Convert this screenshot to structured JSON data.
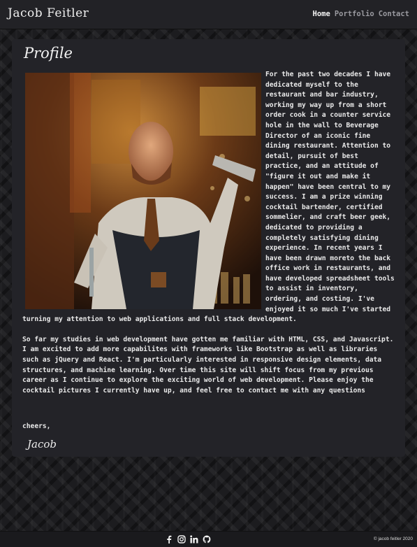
{
  "header": {
    "brand": "Jacob Feitler",
    "nav": [
      "Home",
      "Portfolio",
      "Contact"
    ]
  },
  "profile": {
    "title": "Profile",
    "paragraph1": "For the past two decades I have dedicated myself to the restaurant and bar industry, working my way up from a short order cook in a counter service hole in the wall to Beverage Director of an iconic fine dining restaurant. Attention to detail, pursuit of best practice, and an attitude of \"figure it out and make it happen\" have been central to my success. I am a prize winning cocktail bartender, certified sommelier, and craft beer geek, dedicated to providing a completely satisfying dining experience. In recent years I have been drawn moreto the back office work in restaurants, and have developed spreadsheet tools to assist in inventory, ordering, and costing. I've enjoyed it so much I've started turning my attention to web applications and full stack development.",
    "paragraph2": "So far my studies in web development have gotten me familiar with HTML, CSS, and Javascript. I am excited to add more capabilites with frameworks like Bootstrap as well as libraries such as jQuery and React. I'm particularly interested in responsive design elements, data structures, and machine learning. Over time this site will shift focus from my previous career as I continue to explore the exciting world of web development. Please enjoy the cocktail pictures I currently have up, and feel free to contact me with any questions",
    "closing": "cheers,",
    "signature": "Jacob"
  },
  "footer": {
    "icons": [
      "facebook-icon",
      "instagram-icon",
      "linkedin-icon",
      "github-icon"
    ],
    "copyright": "© jacob feitler 2020"
  }
}
